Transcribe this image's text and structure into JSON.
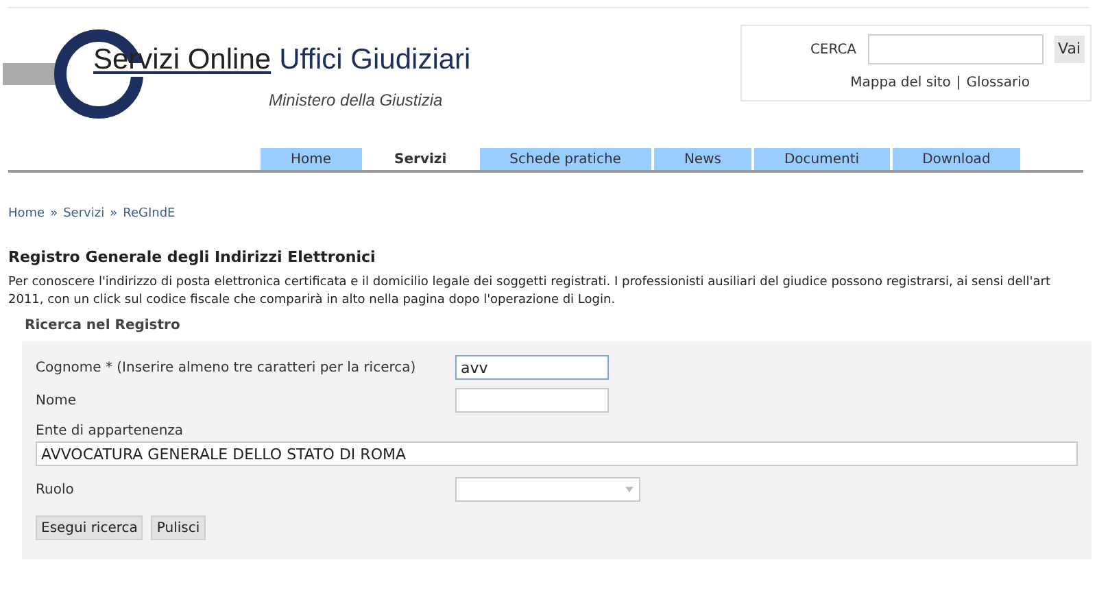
{
  "header": {
    "title_prefix": "Servizi Online",
    "title_suffix": "Uffici Giudiziari",
    "subtitle": "Ministero della Giustizia"
  },
  "search": {
    "label": "CERCA",
    "button": "Vai",
    "links": [
      "Mappa del sito",
      "Glossario"
    ],
    "separator": "|"
  },
  "tabs": [
    {
      "label": "Home",
      "selected": false
    },
    {
      "label": "Servizi",
      "selected": true
    },
    {
      "label": "Schede pratiche",
      "selected": false
    },
    {
      "label": "News",
      "selected": false
    },
    {
      "label": "Documenti",
      "selected": false
    },
    {
      "label": "Download",
      "selected": false
    }
  ],
  "breadcrumb": {
    "items": [
      "Home",
      "Servizi",
      "ReGIndE"
    ],
    "separator": "»"
  },
  "page": {
    "title": "Registro Generale degli Indirizzi Elettronici",
    "intro": "Per conoscere l'indirizzo di posta elettronica certificata e il domicilio legale dei soggetti registrati. I professionisti ausiliari del giudice possono registrarsi, ai sensi dell'art",
    "intro_line_2": "2011, con un click sul codice fiscale che comparirà in alto nella pagina dopo l'operazione di Login."
  },
  "form": {
    "title": "Ricerca nel Registro",
    "fields": [
      {
        "kind": "input",
        "label": "Cognome * (Inserire almeno tre caratteri per la ricerca)",
        "value": "avv",
        "focused": true
      },
      {
        "kind": "input",
        "label": "Nome",
        "focused": false
      },
      {
        "kind": "wide",
        "label": "Ente di appartenenza",
        "value": "AVVOCATURA GENERALE DELLO STATO DI ROMA",
        "focused": false
      },
      {
        "kind": "select",
        "label": "Ruolo",
        "focused": false
      }
    ],
    "buttons": [
      "Esegui ricerca",
      "Pulisci"
    ]
  }
}
